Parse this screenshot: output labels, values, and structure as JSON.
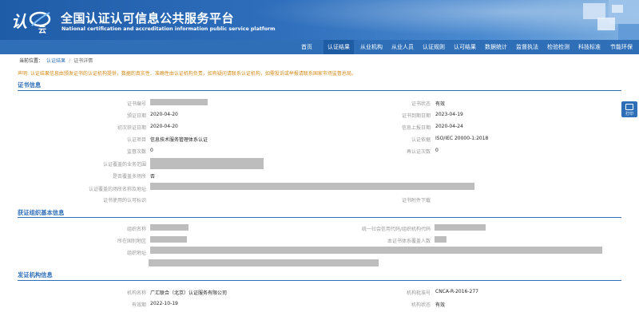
{
  "header": {
    "title": "全国认证认可信息公共服务平台",
    "subtitle": "National certification and accreditation information public service platform",
    "logo_text": "认云"
  },
  "nav": {
    "items": [
      "首页",
      "认证结果",
      "从业机构",
      "从业人员",
      "认证规则",
      "认可结果",
      "数据统计",
      "监督执法",
      "检验检测",
      "科技标准",
      "节能环保"
    ]
  },
  "breadcrumb": {
    "prefix": "当前位置：",
    "link": "认证结果",
    "sep": "/",
    "current": "证书详情"
  },
  "notice": "声明: 认证结果信息由颁发证书的认证机构提供，数据的真实性、准确性由认证机构负责，如有疑问请联系认证机构，如需投诉或举报请联系国家市场监督总局。",
  "side_button": {
    "label": "打印"
  },
  "cert_section": {
    "title": "证书信息",
    "left_labels": [
      "证书编号",
      "颁证日期",
      "初次获证日期",
      "认证项目",
      "监督次数",
      "认证覆盖的业务范围",
      "是否覆盖多场所",
      "认证覆盖的场所名称及地址",
      "证书使用的认可标识"
    ],
    "left_values": [
      "",
      "2020-04-20",
      "2020-04-20",
      "信息技术服务管理体系认证",
      "0",
      "",
      "否",
      "",
      ""
    ],
    "right_labels": [
      "证书状态",
      "证书到期日期",
      "信息上报日期",
      "认证依据",
      "再认证次数",
      "",
      "",
      "",
      "证书附件下载"
    ],
    "right_values": [
      "有效",
      "2023-04-19",
      "2020-04-24",
      "ISO/IEC 20000-1:2018",
      "0",
      "",
      "",
      "",
      ""
    ]
  },
  "org_section": {
    "title": "获证组织基本信息",
    "left_labels": [
      "组织名称",
      "所在国别地区",
      "组织地址"
    ],
    "right_labels": [
      "统一社会信用代码/组织机构代码",
      "本证书体系覆盖人数"
    ]
  },
  "issuer_section": {
    "title": "发证机构信息",
    "left_labels": [
      "机构名称",
      "有效期"
    ],
    "left_values": [
      "广汇联合（北京）认证服务有限公司",
      "2022-10-19"
    ],
    "right_labels": [
      "机构批准号",
      "机构状态"
    ],
    "right_values": [
      "CNCA-R-2016-277",
      "有效"
    ]
  }
}
